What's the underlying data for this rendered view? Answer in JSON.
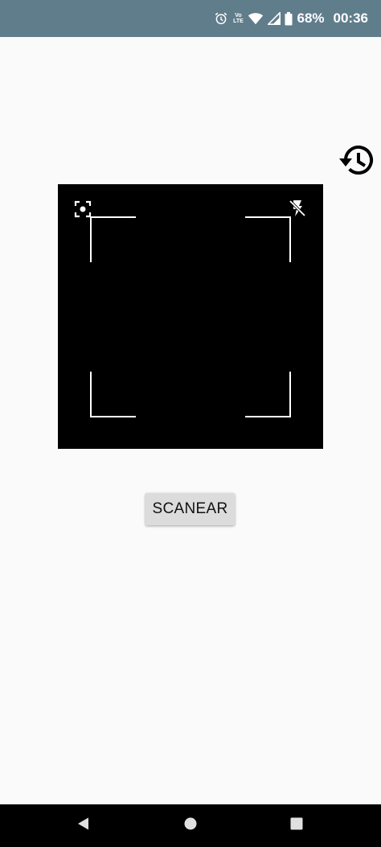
{
  "status_bar": {
    "icons": [
      "alarm-icon",
      "volte-lte-icon",
      "wifi-icon",
      "signal-icon",
      "battery-icon"
    ],
    "lte_top": "Vo",
    "lte_bottom": "LTE",
    "battery": "68%",
    "time": "00:36",
    "color": "#607d8b"
  },
  "history_button": {
    "icon": "history-icon"
  },
  "scanner": {
    "focus_icon": "focus-icon",
    "flash_icon": "flash-off-icon",
    "background": "#000000"
  },
  "scan_button": {
    "label": "SCANEAR"
  },
  "nav_bar": {
    "items": [
      "back-icon",
      "home-icon",
      "recents-icon"
    ]
  }
}
